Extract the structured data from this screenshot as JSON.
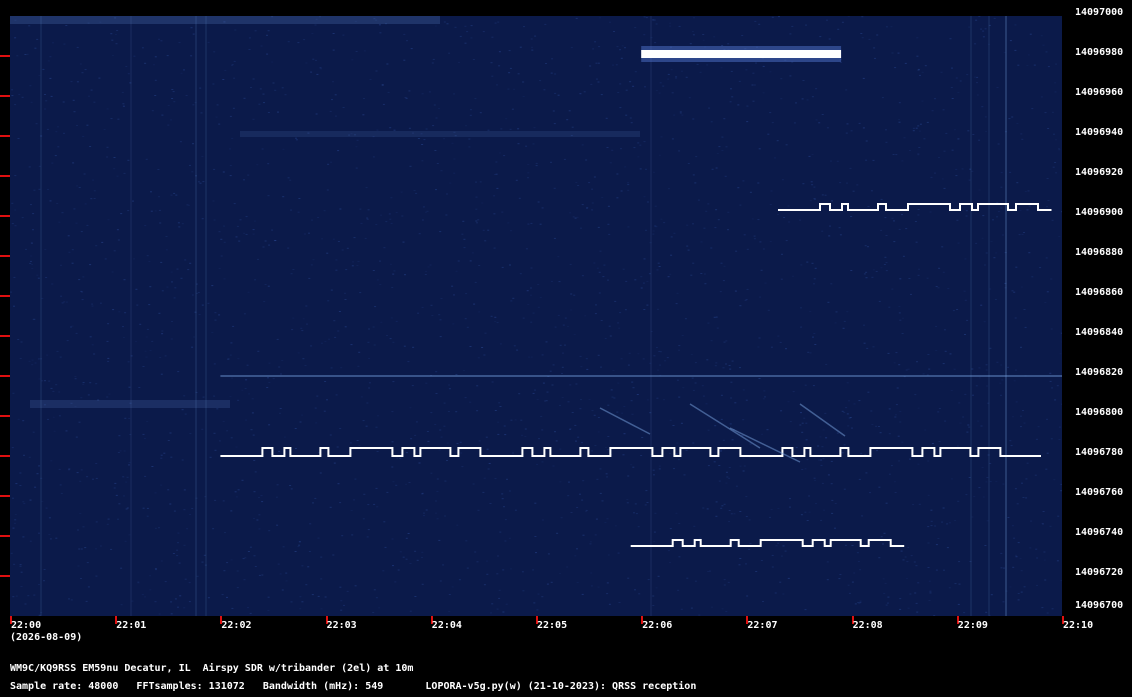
{
  "chart_data": {
    "type": "heatmap",
    "y_axis": {
      "ticks": [
        "14097000",
        "14096980",
        "14096960",
        "14096940",
        "14096920",
        "14096900",
        "14096880",
        "14096860",
        "14096840",
        "14096820",
        "14096800",
        "14096780",
        "14096760",
        "14096740",
        "14096720",
        "14096700"
      ]
    },
    "x_axis": {
      "ticks": [
        "22:00",
        "22:01",
        "22:02",
        "22:03",
        "22:04",
        "22:05",
        "22:06",
        "22:07",
        "22:08",
        "22:09",
        "22:10"
      ],
      "date_label": "(2026-08-09)"
    },
    "signals": [
      {
        "name": "strong-carrier",
        "freq": 14096981,
        "t_start": "22:06.0",
        "t_end": "22:07.9"
      },
      {
        "name": "main-fsk",
        "freq_low": 14096780,
        "freq_high": 14096784,
        "t_start": "22:02.0",
        "t_end": "22:09.8"
      },
      {
        "name": "upper-fsk",
        "freq_low": 14096903,
        "freq_high": 14096906,
        "t_start": "22:07.3",
        "t_end": "22:09.9"
      },
      {
        "name": "lower-fsk",
        "freq_low": 14096735,
        "freq_high": 14096738,
        "t_start": "22:05.9",
        "t_end": "22:08.5"
      },
      {
        "name": "faint-line",
        "freq": 14096820,
        "t_start": "22:02.0",
        "t_end": "22:10.0"
      }
    ]
  },
  "footer": {
    "line1": "WM9C/KQ9RSS EM59nu Decatur, IL  Airspy SDR w/tribander (2el) at 10m",
    "line2": "Sample rate: 48000   FFTsamples: 131072   Bandwidth (mHz): 549       LOPORA-v5g.py(w) (21-10-2023): QRSS reception"
  }
}
